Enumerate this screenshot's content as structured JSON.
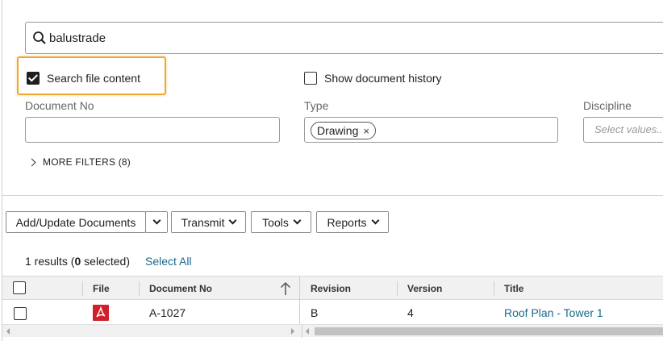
{
  "search": {
    "value": "balustrade",
    "placeholder": ""
  },
  "options": {
    "search_file_content": {
      "label": "Search file content",
      "checked": true
    },
    "show_document_history": {
      "label": "Show document history",
      "checked": false
    }
  },
  "filters": {
    "document_no": {
      "label": "Document No",
      "value": ""
    },
    "type": {
      "label": "Type",
      "chips": [
        "Drawing"
      ]
    },
    "discipline": {
      "label": "Discipline",
      "placeholder": "Select values..."
    },
    "more_filters": "MORE FILTERS (8)"
  },
  "toolbar": {
    "add_update": "Add/Update Documents",
    "transmit": "Transmit",
    "tools": "Tools",
    "reports": "Reports"
  },
  "results": {
    "count": "1",
    "count_suffix": " results (",
    "selected": "0",
    "selected_suffix": " selected)",
    "select_all": "Select All"
  },
  "table": {
    "columns": [
      "File",
      "Document No",
      "Revision",
      "Version",
      "Title"
    ],
    "rows": [
      {
        "file_icon": "pdf-icon",
        "document_no": "A-1027",
        "revision": "B",
        "version": "4",
        "title": "Roof Plan - Tower 1"
      }
    ]
  },
  "colors": {
    "accent_link": "#1a6a8a",
    "highlight": "#f0a830",
    "pdf": "#d0202a"
  }
}
